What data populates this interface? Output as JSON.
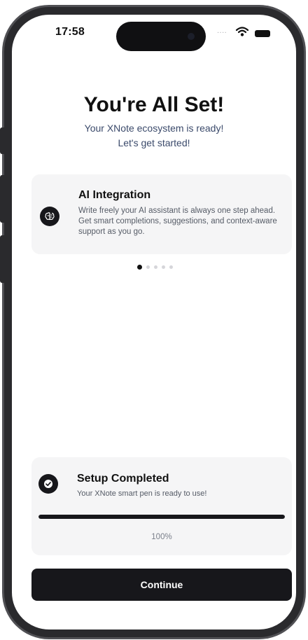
{
  "status_bar": {
    "time": "17:58",
    "signal_text": "....",
    "wifi_icon": "wifi-icon",
    "battery_icon": "battery-icon"
  },
  "header": {
    "title": "You're All Set!",
    "subtitle_line1": "Your XNote ecosystem is ready!",
    "subtitle_line2": "Let's get started!"
  },
  "feature": {
    "icon": "brain-icon",
    "title": "AI Integration",
    "description": "Write freely your AI assistant is always one step ahead. Get smart completions, suggestions, and context-aware support as you go."
  },
  "carousel": {
    "page_count": 5,
    "active_index": 0
  },
  "setup": {
    "icon": "check-circle-icon",
    "title": "Setup Completed",
    "description": "Your XNote smart pen is ready to use!",
    "progress_percent": 100,
    "progress_label": "100%"
  },
  "actions": {
    "continue_label": "Continue"
  },
  "colors": {
    "primary": "#17171b",
    "card_background": "#f5f5f6",
    "subtitle_text": "#3b4a6b"
  }
}
